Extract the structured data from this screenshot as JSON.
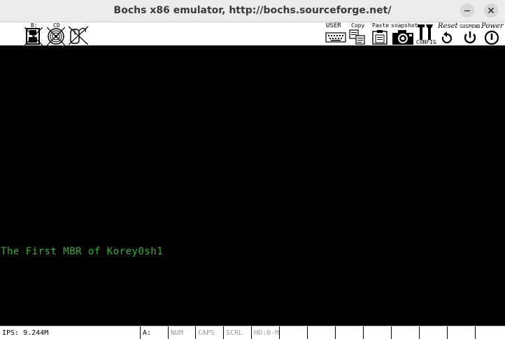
{
  "window": {
    "title": "Bochs x86 emulator, http://bochs.sourceforge.net/"
  },
  "toolbar": {
    "left": [
      {
        "name": "floppy-b",
        "label": "B:",
        "icon": "floppy-icon"
      },
      {
        "name": "cdrom",
        "label": "CD",
        "icon": "cdrom-icon"
      },
      {
        "name": "mouse",
        "label": "",
        "icon": "mouse-icon"
      }
    ],
    "right": [
      {
        "name": "user",
        "label": "USER",
        "icon": "keyboard-icon"
      },
      {
        "name": "copy",
        "label": "Copy",
        "icon": "copy-icon"
      },
      {
        "name": "paste",
        "label": "Paste",
        "icon": "paste-icon"
      },
      {
        "name": "snapshot",
        "label": "snapshot",
        "icon": "camera-icon"
      },
      {
        "name": "config",
        "label": "CONFIG",
        "icon": "config-icon"
      },
      {
        "name": "reset",
        "label": "Reset",
        "icon": "reset-icon"
      },
      {
        "name": "suspend",
        "label": "SUSPEND",
        "icon": "suspend-icon"
      },
      {
        "name": "power",
        "label": "Power",
        "icon": "power-icon"
      }
    ]
  },
  "screen": {
    "text_color": "#2fb52f",
    "line": "The First MBR of Korey0sh1"
  },
  "statusbar": {
    "ips": "IPS: 9.244M",
    "drive_a": "A:",
    "num": "NUM",
    "caps": "CAPS",
    "scrl": "SCRL",
    "hd": "HD:0-M"
  }
}
